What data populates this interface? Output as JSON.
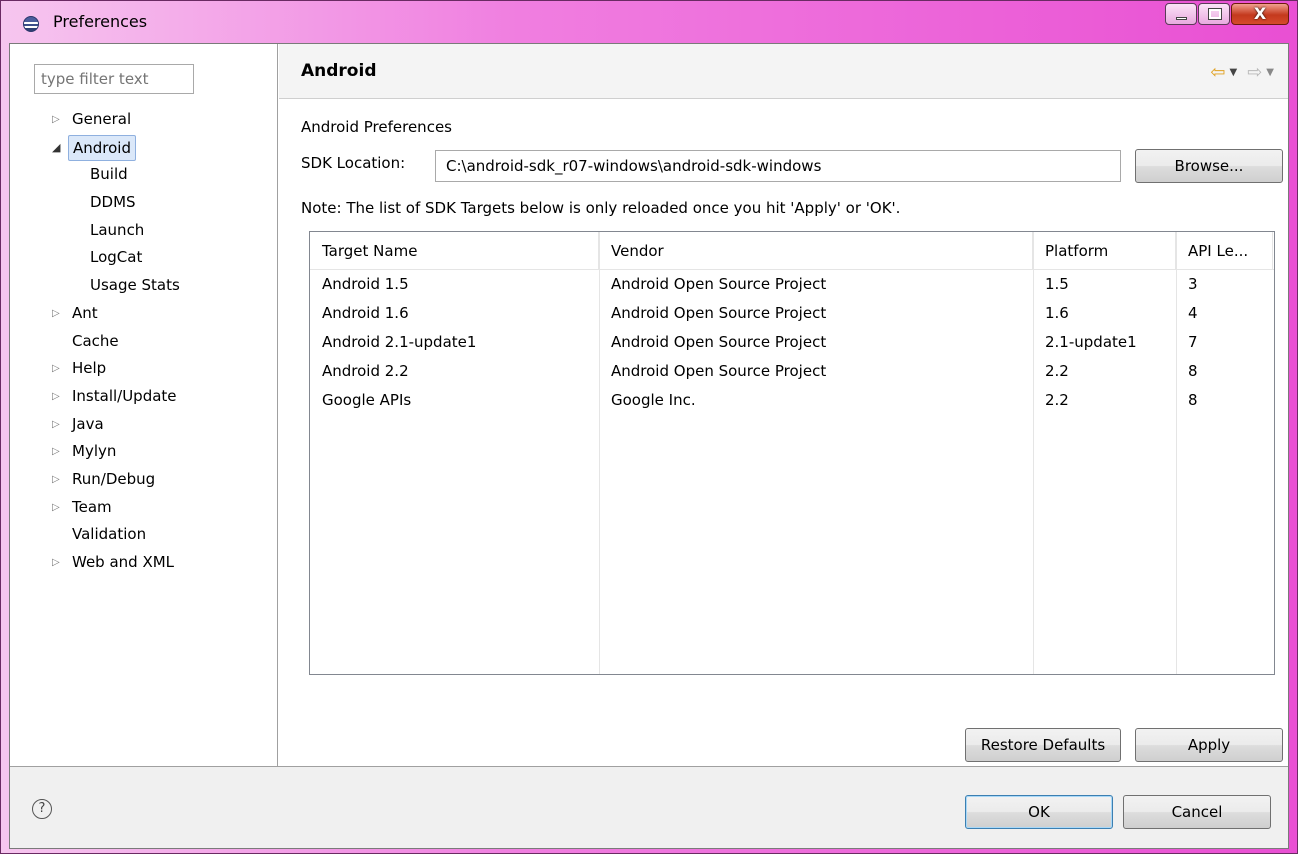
{
  "window": {
    "title": "Preferences",
    "controls": {
      "minimize_icon": "minimize-icon",
      "maximize_icon": "maximize-icon",
      "close_glyph": "X"
    }
  },
  "filter": {
    "placeholder": "type filter text",
    "value": ""
  },
  "tree": {
    "items": [
      {
        "label": "General",
        "twisty": "▷",
        "level": 0
      },
      {
        "label": "Android",
        "twisty": "◢",
        "level": 0,
        "selected": true
      },
      {
        "label": "Build",
        "twisty": "",
        "level": 1
      },
      {
        "label": "DDMS",
        "twisty": "",
        "level": 1
      },
      {
        "label": "Launch",
        "twisty": "",
        "level": 1
      },
      {
        "label": "LogCat",
        "twisty": "",
        "level": 1
      },
      {
        "label": "Usage Stats",
        "twisty": "",
        "level": 1
      },
      {
        "label": "Ant",
        "twisty": "▷",
        "level": 0
      },
      {
        "label": "Cache",
        "twisty": "",
        "level": 0
      },
      {
        "label": "Help",
        "twisty": "▷",
        "level": 0
      },
      {
        "label": "Install/Update",
        "twisty": "▷",
        "level": 0
      },
      {
        "label": "Java",
        "twisty": "▷",
        "level": 0
      },
      {
        "label": "Mylyn",
        "twisty": "▷",
        "level": 0
      },
      {
        "label": "Run/Debug",
        "twisty": "▷",
        "level": 0
      },
      {
        "label": "Team",
        "twisty": "▷",
        "level": 0
      },
      {
        "label": "Validation",
        "twisty": "",
        "level": 0
      },
      {
        "label": "Web and XML",
        "twisty": "▷",
        "level": 0
      }
    ]
  },
  "page": {
    "title": "Android",
    "nav": {
      "back": "⇦",
      "forward": "⇨",
      "dropdown": "▼"
    },
    "section_label": "Android Preferences",
    "sdk_label": "SDK Location:",
    "sdk_value": "C:\\android-sdk_r07-windows\\android-sdk-windows",
    "browse_label": "Browse...",
    "note": "Note: The list of SDK Targets below is only reloaded once you hit 'Apply' or 'OK'.",
    "table": {
      "columns": [
        "Target Name",
        "Vendor",
        "Platform",
        "API Le..."
      ],
      "rows": [
        [
          "Android 1.5",
          "Android Open Source Project",
          "1.5",
          "3"
        ],
        [
          "Android 1.6",
          "Android Open Source Project",
          "1.6",
          "4"
        ],
        [
          "Android 2.1-update1",
          "Android Open Source Project",
          "2.1-update1",
          "7"
        ],
        [
          "Android 2.2",
          "Android Open Source Project",
          "2.2",
          "8"
        ],
        [
          "Google APIs",
          "Google Inc.",
          "2.2",
          "8"
        ]
      ]
    },
    "restore_label": "Restore Defaults",
    "apply_label": "Apply"
  },
  "footer": {
    "help_glyph": "?",
    "ok_label": "OK",
    "cancel_label": "Cancel"
  }
}
